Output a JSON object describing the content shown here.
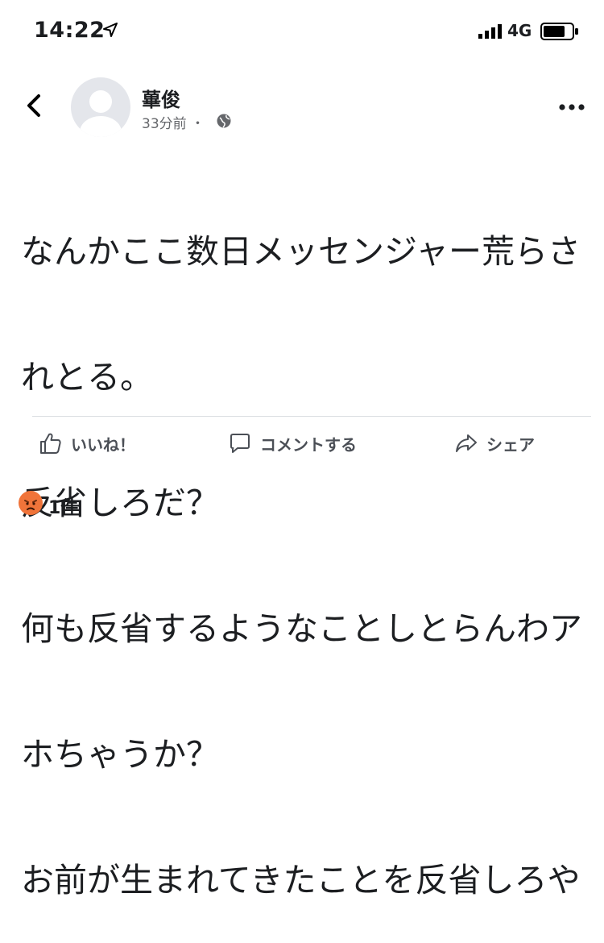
{
  "status_bar": {
    "time": "14:22",
    "network": "4G"
  },
  "post": {
    "author": "蓽俊",
    "meta": "33分前 ・",
    "body_lines": [
      "なんかここ数日メッセンジャー荒らさ",
      "れとる。",
      "反省しろだ？",
      "何も反省するようなことしとらんわア",
      "ホちゃうか？",
      "お前が生まれてきたことを反省しろや"
    ]
  },
  "actions": {
    "like_label": "いいね！",
    "comment_label": "コメントする",
    "share_label": "シェア"
  },
  "reactions": {
    "count": "1件"
  },
  "icons": {
    "location": "location-arrow-icon",
    "signal": "signal-bars-icon",
    "battery": "battery-icon",
    "back": "back-chevron-icon",
    "globe": "globe-icon",
    "more": "more-dots-icon",
    "like": "thumbs-up-icon",
    "comment": "comment-bubble-icon",
    "share": "share-arrow-icon",
    "reaction": "angry-face-icon"
  },
  "colors": {
    "reaction": "#f0743a",
    "text": "#1c1e21",
    "muted": "#65676b"
  }
}
